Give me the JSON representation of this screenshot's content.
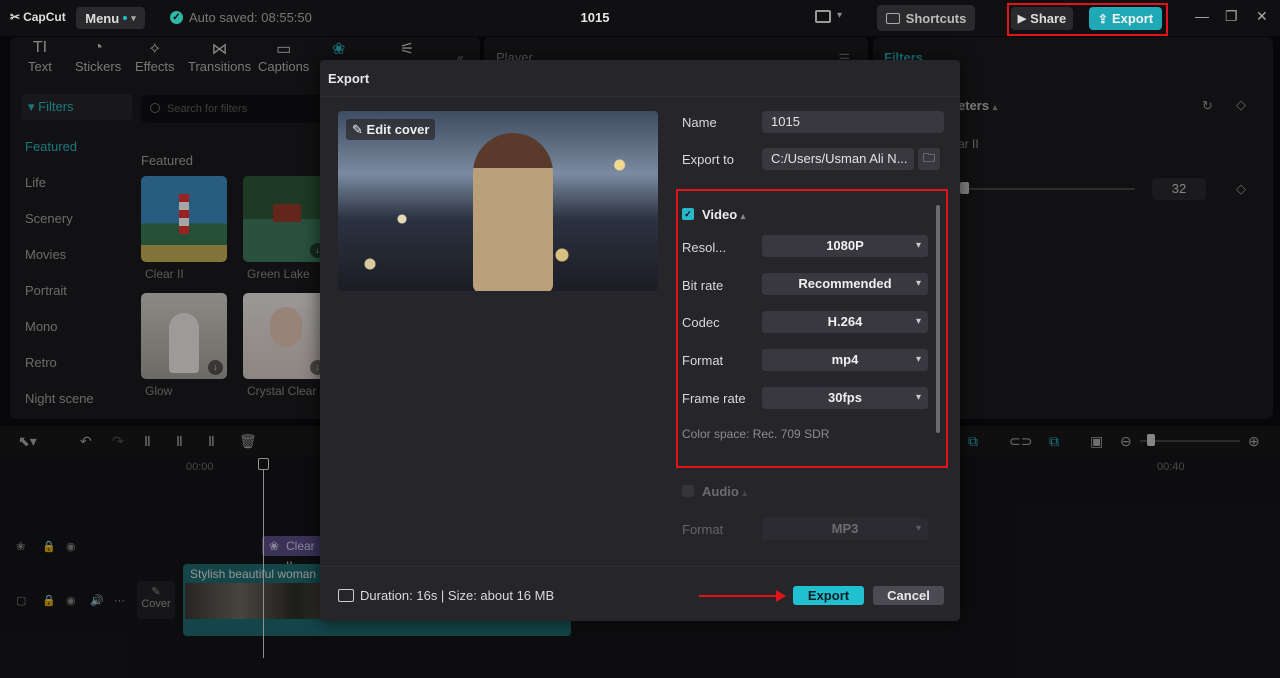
{
  "app": {
    "logo": "CapCut",
    "menu_label": "Menu",
    "autosave": "Auto saved: 08:55:50",
    "project_title": "1015",
    "shortcuts_label": "Shortcuts",
    "share_label": "Share",
    "export_label": "Export"
  },
  "tools": [
    "Text",
    "Stickers",
    "Effects",
    "Transitions",
    "Captions"
  ],
  "tool_icons": [
    "text-icon",
    "stickers-icon",
    "effects-icon",
    "transitions-icon",
    "captions-icon",
    "filters-icon",
    "adjustment-icon"
  ],
  "sidebar": {
    "header": "Filters",
    "items": [
      "Featured",
      "Life",
      "Scenery",
      "Movies",
      "Portrait",
      "Mono",
      "Retro",
      "Night scene"
    ]
  },
  "search": {
    "placeholder": "Search for filters"
  },
  "featured_heading": "Featured",
  "filter_thumbs": [
    "Clear II",
    "Green Lake",
    "Glow",
    "Crystal Clear"
  ],
  "player": {
    "title": "Player"
  },
  "right_panel": {
    "tab": "Filters",
    "params_title": "eters",
    "filter_name": "ar II",
    "value": "32"
  },
  "timeline": {
    "ruler_start": "00:00",
    "ruler_end": "00:40",
    "filter_clip": "Clear II",
    "video_clip": "Stylish beautiful woman",
    "cover_label": "Cover"
  },
  "dialog": {
    "title": "Export",
    "edit_cover": "Edit cover",
    "name_label": "Name",
    "name_value": "1015",
    "export_to_label": "Export to",
    "export_to_value": "C:/Users/Usman Ali N...",
    "video_section": "Video",
    "video_settings": [
      {
        "label": "Resol...",
        "value": "1080P"
      },
      {
        "label": "Bit rate",
        "value": "Recommended"
      },
      {
        "label": "Codec",
        "value": "H.264"
      },
      {
        "label": "Format",
        "value": "mp4"
      },
      {
        "label": "Frame rate",
        "value": "30fps"
      }
    ],
    "color_space": "Color space: Rec. 709 SDR",
    "audio_section": "Audio",
    "audio_format_label": "Format",
    "audio_format_value": "MP3",
    "duration_text": "Duration: 16s | Size: about 16 MB",
    "export_button": "Export",
    "cancel_button": "Cancel"
  },
  "colors": {
    "accent": "#20c0d0",
    "highlight": "#e0141a",
    "dialog_bg": "#25252a"
  }
}
